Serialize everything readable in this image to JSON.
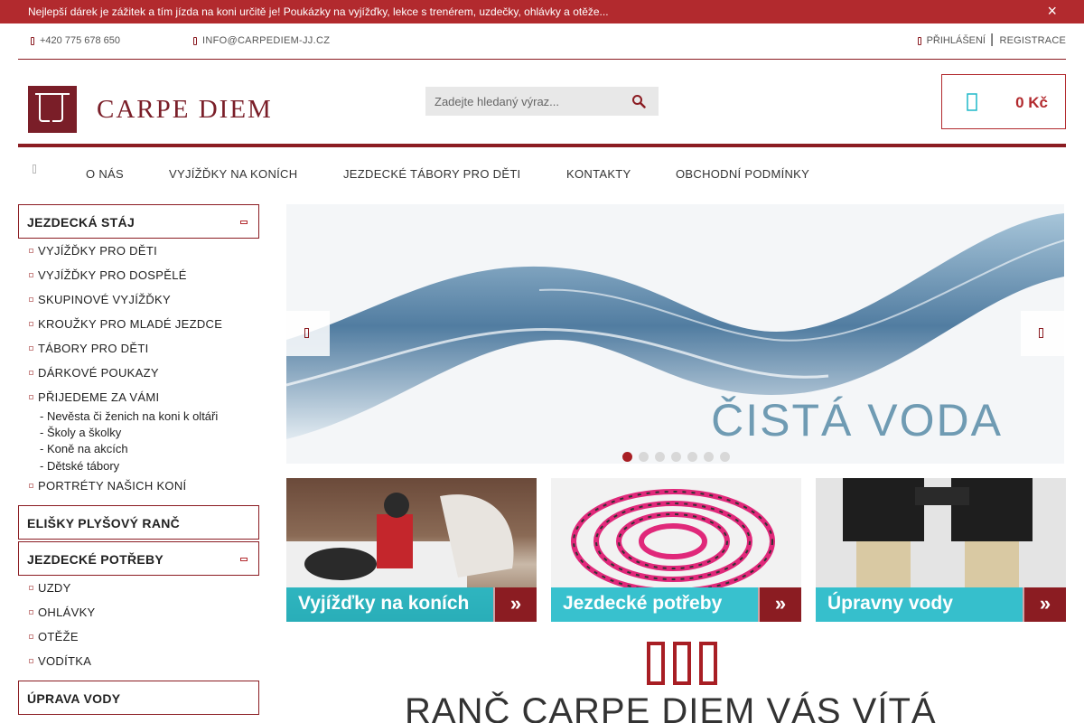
{
  "promo": {
    "text": "Nejlepší dárek je zážitek a tím jízda na koni určitě je! Poukázky na vyjížďky, lekce s trenérem, uzdečky, ohlávky a otěže...",
    "close": "×"
  },
  "topbar": {
    "phone": "+420 775 678 650",
    "email": "INFO@CARPEDIEM-JJ.CZ",
    "login": "PŘIHLÁŠENÍ",
    "separator": "|",
    "register": "REGISTRACE"
  },
  "header": {
    "logo_text": "CARPE DIEM",
    "search_placeholder": "Zadejte hledaný výraz...",
    "cart_total": "0 Kč"
  },
  "nav": {
    "items": [
      "O NÁS",
      "VYJÍŽĎKY NA KONÍCH",
      "JEZDECKÉ TÁBORY PRO DĚTI",
      "KONTAKTY",
      "OBCHODNÍ PODMÍNKY"
    ]
  },
  "sidebar": {
    "cat1": {
      "title": "JEZDECKÁ STÁJ",
      "items": [
        "VYJÍŽĎKY PRO DĚTI",
        "VYJÍŽĎKY PRO DOSPĚLÉ",
        "SKUPINOVÉ VYJÍŽĎKY",
        "KROUŽKY PRO MLADÉ JEZDCE",
        "TÁBORY PRO DĚTI",
        "DÁRKOVÉ POUKAZY",
        "PŘIJEDEME ZA VÁMI"
      ],
      "subitems": [
        "- Nevěsta či ženich na koni k oltáři",
        "- Školy a školky",
        "- Koně na akcích",
        "- Dětské tábory"
      ],
      "last": "PORTRÉTY NAŠICH KONÍ"
    },
    "cat2": {
      "title": "ELIŠKY PLYŠOVÝ RANČ"
    },
    "cat3": {
      "title": "JEZDECKÉ POTŘEBY",
      "items": [
        "UZDY",
        "OHLÁVKY",
        "OTĚŽE",
        "VODÍTKA"
      ]
    },
    "cat4": {
      "title": "ÚPRAVA VODY"
    }
  },
  "slider": {
    "caption": "ČISTÁ VODA",
    "dots": 7,
    "active_dot": 1
  },
  "banners": [
    {
      "label": "Vyjížďky na koních"
    },
    {
      "label": "Jezdecké potřeby"
    },
    {
      "label": "Úpravny vody"
    }
  ],
  "welcome": {
    "title": "RANČ CARPE DIEM VÁS VÍTÁ"
  },
  "colors": {
    "brand": "#8b1c22",
    "promo": "#b22a2e",
    "accent_teal": "#1eb9c8"
  }
}
